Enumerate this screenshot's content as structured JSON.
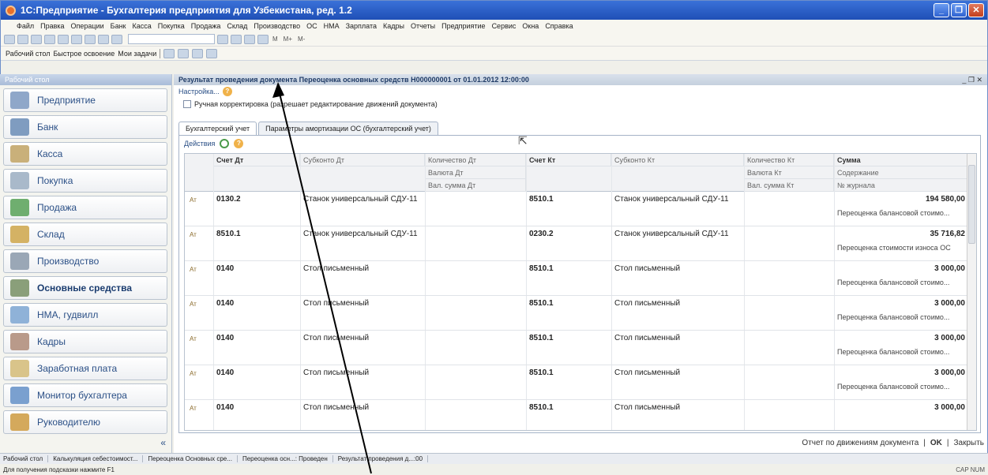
{
  "app": {
    "title": "1С:Предприятие - Бухгалтерия предприятия для Узбекистана, ред. 1.2",
    "menu": [
      "Файл",
      "Правка",
      "Операции",
      "Банк",
      "Касса",
      "Покупка",
      "Продажа",
      "Склад",
      "Производство",
      "ОС",
      "НМА",
      "Зарплата",
      "Кадры",
      "Отчеты",
      "Предприятие",
      "Сервис",
      "Окна",
      "Справка"
    ],
    "toolbar2": {
      "desktop": "Рабочий стол",
      "quick": "Быстрое освоение",
      "tasks": "Мои задачи"
    },
    "toolbar_text": [
      "M",
      "M+",
      "M-"
    ]
  },
  "sidebar": {
    "title": "Рабочий стол",
    "items": [
      {
        "label": "Предприятие"
      },
      {
        "label": "Банк"
      },
      {
        "label": "Касса"
      },
      {
        "label": "Покупка"
      },
      {
        "label": "Продажа"
      },
      {
        "label": "Склад"
      },
      {
        "label": "Производство"
      },
      {
        "label": "Основные средства"
      },
      {
        "label": "НМА, гудвилл"
      },
      {
        "label": "Кадры"
      },
      {
        "label": "Заработная плата"
      },
      {
        "label": "Монитор бухгалтера"
      },
      {
        "label": "Руководителю"
      }
    ],
    "collapse": "«"
  },
  "doc": {
    "title": "Результат проведения документа Переоценка основных средств Н000000001 от 01.01.2012 12:00:00",
    "settings": "Настройка...",
    "manual_label": "Ручная корректировка (разрешает редактирование движений документа)",
    "tabs": [
      "Бухгалтерский учет",
      "Параметры амортизации ОС (бухгалтерский учет)"
    ],
    "actions": "Действия"
  },
  "grid": {
    "headers": {
      "debit_account": "Счет Дт",
      "subconto_dt": "Субконто Дт",
      "qty_dt": "Количество Дт",
      "currency_dt": "Валюта Дт",
      "cur_sum_dt": "Вал. сумма Дт",
      "credit_account": "Счет Кт",
      "subconto_kt": "Субконто Кт",
      "qty_kt": "Количество Кт",
      "currency_kt": "Валюта Кт",
      "cur_sum_kt": "Вал. сумма Кт",
      "sum": "Сумма",
      "content": "Содержание",
      "journal": "№ журнала"
    },
    "rows": [
      {
        "dt": "0130.2",
        "sub_dt": "Станок универсальный СДУ-11",
        "kt": "8510.1",
        "sub_kt": "Станок универсальный СДУ-11",
        "sum": "194 580,00",
        "note": "Переоценка балансовой стоимо..."
      },
      {
        "dt": "8510.1",
        "sub_dt": "Станок универсальный СДУ-11",
        "kt": "0230.2",
        "sub_kt": "Станок универсальный СДУ-11",
        "sum": "35 716,82",
        "note": "Переоценка стоимости износа ОС"
      },
      {
        "dt": "0140",
        "sub_dt": "Стол письменный",
        "kt": "8510.1",
        "sub_kt": "Стол письменный",
        "sum": "3 000,00",
        "note": "Переоценка балансовой стоимо..."
      },
      {
        "dt": "0140",
        "sub_dt": "Стол письменный",
        "kt": "8510.1",
        "sub_kt": "Стол письменный",
        "sum": "3 000,00",
        "note": "Переоценка балансовой стоимо..."
      },
      {
        "dt": "0140",
        "sub_dt": "Стол письменный",
        "kt": "8510.1",
        "sub_kt": "Стол письменный",
        "sum": "3 000,00",
        "note": "Переоценка балансовой стоимо..."
      },
      {
        "dt": "0140",
        "sub_dt": "Стол письменный",
        "kt": "8510.1",
        "sub_kt": "Стол письменный",
        "sum": "3 000,00",
        "note": "Переоценка балансовой стоимо..."
      },
      {
        "dt": "0140",
        "sub_dt": "Стол письменный",
        "kt": "8510.1",
        "sub_kt": "Стол письменный",
        "sum": "3 000,00",
        "note": ""
      }
    ]
  },
  "footer": {
    "report": "Отчет по движениям документа",
    "ok": "OK",
    "close": "Закрыть"
  },
  "taskbar": [
    "Рабочий стол",
    "Калькуляция себестоимост...",
    "Переоценка Основных сре...",
    "Переоценка осн...: Проведен",
    "Результат проведения д...:00"
  ],
  "status": {
    "hint": "Для получения подсказки нажмите F1",
    "caps": "CAP",
    "num": "NUM"
  }
}
